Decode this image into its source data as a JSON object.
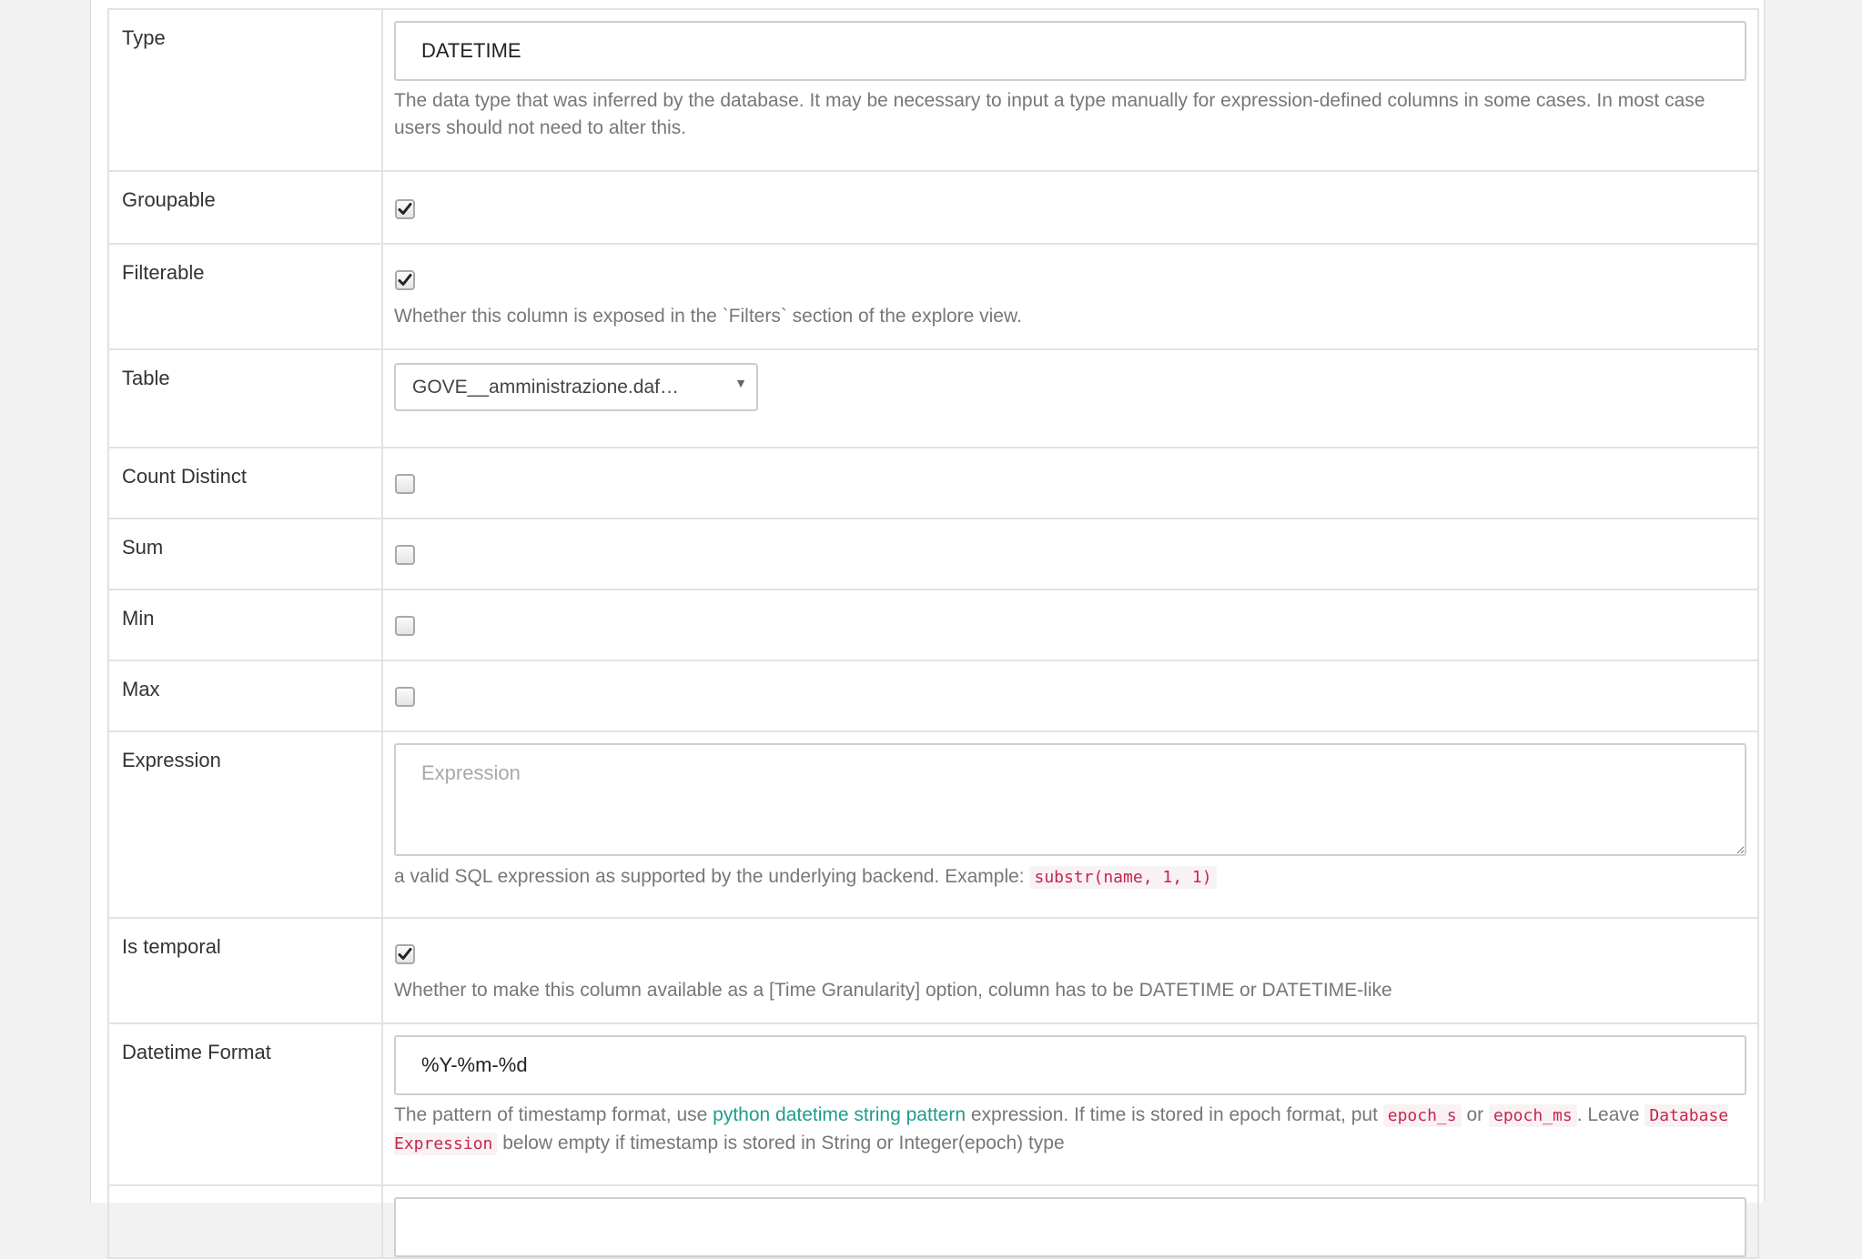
{
  "rows": {
    "type": {
      "label": "Type",
      "value": "DATETIME",
      "help": "The data type that was inferred by the database. It may be necessary to input a type manually for expression-defined columns in some cases. In most case users should not need to alter this."
    },
    "groupable": {
      "label": "Groupable",
      "checked": true
    },
    "filterable": {
      "label": "Filterable",
      "checked": true,
      "help": "Whether this column is exposed in the `Filters` section of the explore view."
    },
    "table": {
      "label": "Table",
      "selected": "GOVE__amministrazione.daf…"
    },
    "count_distinct": {
      "label": "Count Distinct",
      "checked": false
    },
    "sum": {
      "label": "Sum",
      "checked": false
    },
    "min": {
      "label": "Min",
      "checked": false
    },
    "max": {
      "label": "Max",
      "checked": false
    },
    "expression": {
      "label": "Expression",
      "placeholder": "Expression",
      "value": "",
      "help_prefix": "a valid SQL expression as supported by the underlying backend. Example:",
      "help_code": "substr(name, 1, 1)"
    },
    "is_temporal": {
      "label": "Is temporal",
      "checked": true,
      "help": "Whether to make this column available as a [Time Granularity] option, column has to be DATETIME or DATETIME-like"
    },
    "datetime_format": {
      "label": "Datetime Format",
      "value": "%Y-%m-%d",
      "help_1": "The pattern of timestamp format, use",
      "help_link": "python datetime string pattern",
      "help_2": "expression. If time is stored in epoch format, put",
      "help_code_1": "epoch_s",
      "help_or": "or",
      "help_code_2": "epoch_ms",
      "help_3": ". Leave",
      "help_code_3": "Database Expression",
      "help_4": "below empty if timestamp is stored in String or Integer(epoch) type"
    }
  }
}
